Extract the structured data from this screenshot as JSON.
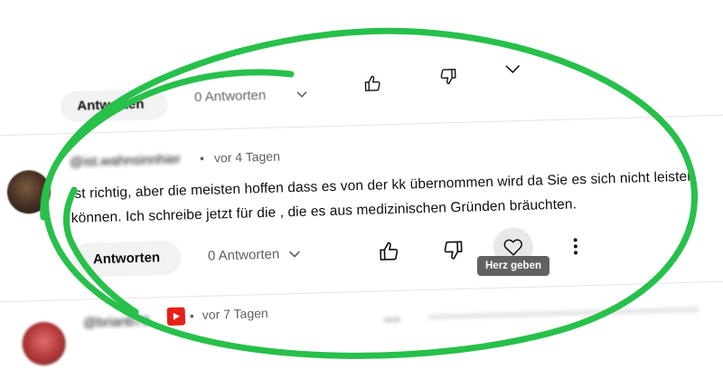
{
  "top_row": {
    "reply_label": "Antworten",
    "replies_label": "0 Antworten",
    "icons": [
      "thumbs-up-icon",
      "thumbs-down-icon",
      "heart-icon"
    ]
  },
  "comment": {
    "author": "@ist.wahnsinnhier",
    "separator": "•",
    "timestamp": "vor 4 Tagen",
    "text": "Ist richtig, aber die meisten hoffen dass es von der kk übernommen wird da Sie es sich nicht leisten können. Ich schreibe jetzt für die , die es aus medizinischen Gründen bräuchten.",
    "reply_label": "Antworten",
    "replies_label": "0 Antworten",
    "heart_tooltip": "Herz geben"
  },
  "next_comment": {
    "author": "@brianb79",
    "separator": "•",
    "timestamp": "vor 7 Tagen",
    "badge_icon": "youtube-badge-icon"
  },
  "colors": {
    "annotation_circle": "#27c04a",
    "youtube_red": "#e62117",
    "tooltip_bg": "#616161"
  }
}
